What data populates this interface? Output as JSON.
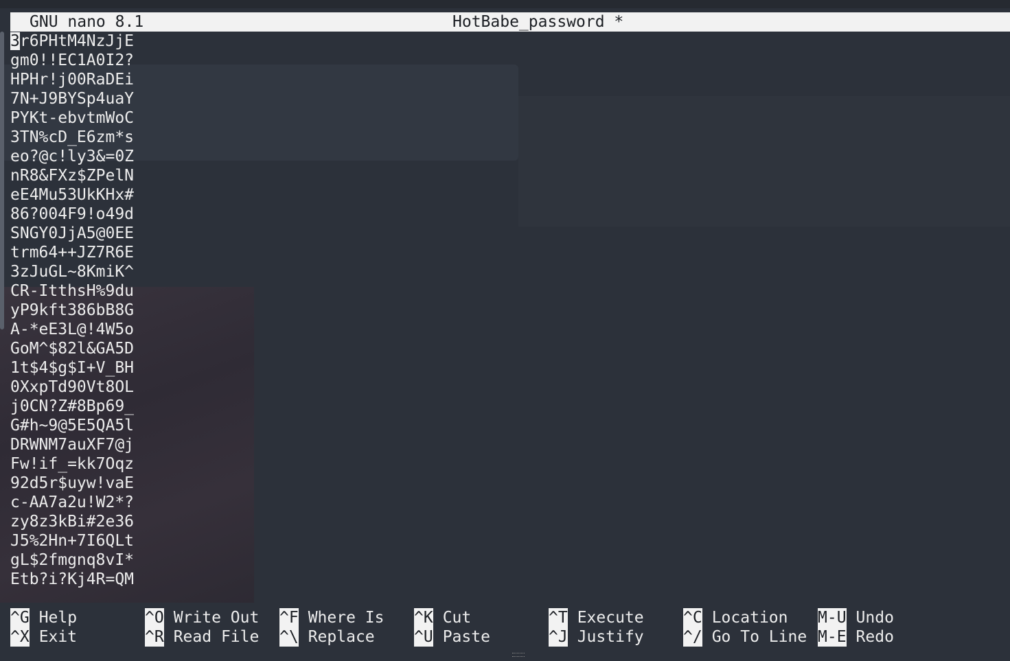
{
  "titlebar": {
    "app": "GNU nano 8.1",
    "filename": "HotBabe_password *"
  },
  "editor": {
    "cursor_char": "3",
    "lines": [
      "3r6PHtM4NzJjE",
      "gm0!!EC1A0I2?",
      "HPHr!j00RaDEi",
      "7N+J9BYSp4uaY",
      "PYKt-ebvtmWoC",
      "3TN%cD_E6zm*s",
      "eo?@c!ly3&=0Z",
      "nR8&FXz$ZPelN",
      "eE4Mu53UkKHx#",
      "86?004F9!o49d",
      "SNGY0JjA5@0EE",
      "trm64++JZ7R6E",
      "3zJuGL~8KmiK^",
      "CR-ItthsH%9du",
      "yP9kft386bB8G",
      "A-*eE3L@!4W5o",
      "GoM^$82l&GA5D",
      "1t$4$g$I+V_BH",
      "0XxpTd90Vt8OL",
      "j0CN?Z#8Bp69_",
      "G#h~9@5E5QA5l",
      "DRWNM7auXF7@j",
      "Fw!if_=kk7Oqz",
      "92d5r$uyw!vaE",
      "c-AA7a2u!W2*?",
      "zy8z3kBi#2e36",
      "J5%2Hn+7I6QLt",
      "gL$2fmgnq8vI*",
      "Etb?i?Kj4R=QM"
    ]
  },
  "shortcuts": {
    "row1": [
      {
        "key": "^G",
        "label": "Help"
      },
      {
        "key": "^O",
        "label": "Write Out"
      },
      {
        "key": "^F",
        "label": "Where Is"
      },
      {
        "key": "^K",
        "label": "Cut"
      },
      {
        "key": "^T",
        "label": "Execute"
      },
      {
        "key": "^C",
        "label": "Location"
      },
      {
        "key": "M-U",
        "label": "Undo"
      }
    ],
    "row2": [
      {
        "key": "^X",
        "label": "Exit"
      },
      {
        "key": "^R",
        "label": "Read File"
      },
      {
        "key": "^\\",
        "label": "Replace"
      },
      {
        "key": "^U",
        "label": "Paste"
      },
      {
        "key": "^J",
        "label": "Justify"
      },
      {
        "key": "^/",
        "label": "Go To Line"
      },
      {
        "key": "M-E",
        "label": "Redo"
      }
    ]
  }
}
